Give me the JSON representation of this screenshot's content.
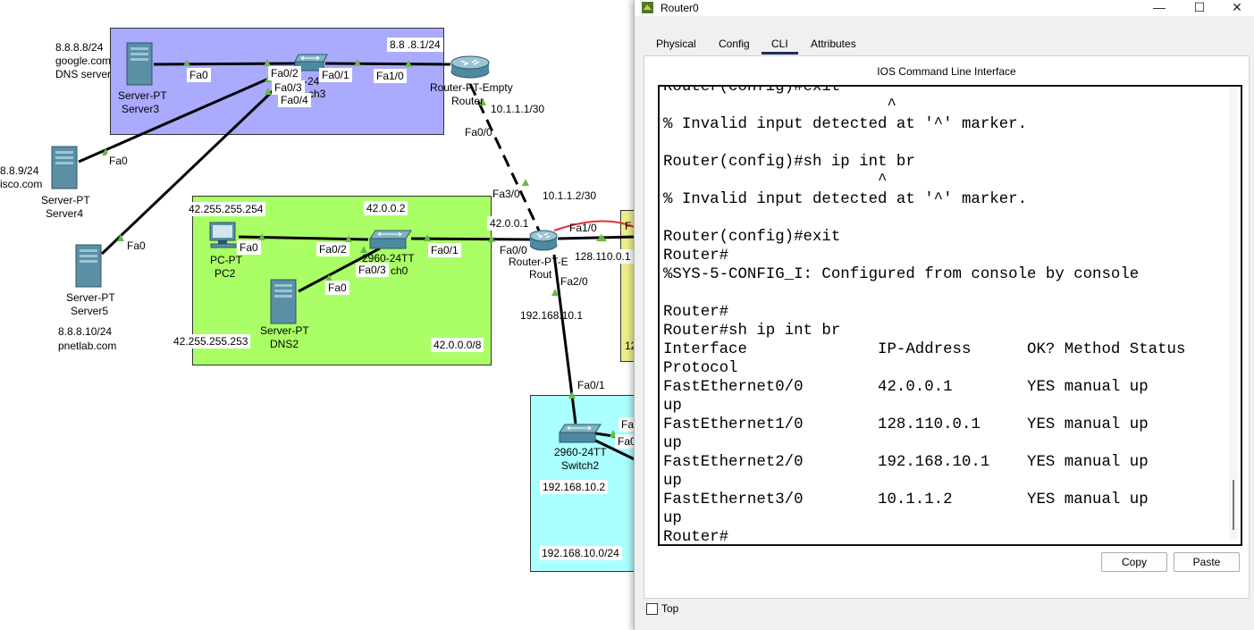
{
  "topology": {
    "labels": {
      "dns_server_ip": "8.8.8.8/24",
      "dns_server_domain": "google.com",
      "dns_server_role": "DNS server",
      "server3_type": "Server-PT",
      "server3_name": "Server3",
      "server3_port": "Fa0",
      "switch3_fa02": "Fa0/2",
      "switch3_fa03": "Fa0/3",
      "switch3_fa04": "Fa0/4",
      "switch3_fa01": "Fa0/1",
      "switch3_name_partial": "-24",
      "switch3_name2_partial": "ch3",
      "router_fa10": "Fa1/0",
      "gateway_ip": "8.8 .8.1/24",
      "router_top_type": "Router-PT-Empty",
      "router_top_name": "Router",
      "router_top_link_ip": "10.1.1.1/30",
      "router_top_fa00": "Fa0/0",
      "server4_ip_partial": "8.8.9/24",
      "server4_domain_partial": "isco.com",
      "server4_port": "Fa0",
      "server4_type": "Server-PT",
      "server4_name": "Server4",
      "server5_port": "Fa0",
      "server5_type": "Server-PT",
      "server5_name": "Server5",
      "server5_ip": "8.8.8.10/24",
      "server5_domain": "pnetlab.com",
      "area_green_ip1": "42.255.255.254",
      "area_green_net": "42.0.0.2",
      "pc2_port": "Fa0",
      "switch0_fa02": "Fa0/2",
      "switch0_name": "2960-24TT",
      "switch0_fa03": "Fa0/3",
      "switch0_name2_partial": "ch0",
      "switch0_fa01": "Fa0/1",
      "pc2_type": "PC-PT",
      "pc2_name": "PC2",
      "dns2_port": "Fa0",
      "dns2_type": "Server-PT",
      "dns2_name": "DNS2",
      "area_green_ip2": "42.255.255.253",
      "area_green_subnet": "42.0.0.0/8",
      "router0_fa30": "Fa3/0",
      "router0_link_ip": "10.1.1.2/30",
      "router0_ip1": "42.0.0.1",
      "router0_fa00": "Fa0/0",
      "router0_fa10": "Fa1/0",
      "router0_ip2": "128.110.0.1",
      "router0_type_partial": "Router-PT-E",
      "router0_name_partial": "Rout",
      "router0_fa20": "Fa2/0",
      "router0_ip3": "192.168.10.1",
      "switch2_fa01": "Fa0/1",
      "switch2_type": "2960-24TT",
      "switch2_name": "Switch2",
      "switch2_ip": "192.168.10.2",
      "switch2_fa_partial1": "Fa",
      "switch2_fa_partial2": "Fa0",
      "area_cyan_subnet": "192.168.10.0/24",
      "yellow_partial1": "F",
      "yellow_partial2": "12"
    },
    "colors": {
      "area_blue": "#aaaaff",
      "area_green": "#aaff66",
      "area_cyan": "#aaffff",
      "area_yellow": "#eeee88",
      "link_up": "#66bb44",
      "annotation_arrow": "#e03030"
    }
  },
  "window": {
    "title": "Router0",
    "controls": {
      "minimize": "—",
      "maximize": "☐",
      "close": "✕"
    },
    "tabs": [
      {
        "label": "Physical"
      },
      {
        "label": "Config"
      },
      {
        "label": "CLI"
      },
      {
        "label": "Attributes"
      }
    ],
    "active_tab": "CLI",
    "panel_title": "IOS Command Line Interface",
    "cli_output": "Router(config)#exit\n                        ^\n% Invalid input detected at '^' marker.\n\nRouter(config)#sh ip int br\n                       ^\n% Invalid input detected at '^' marker.\n\nRouter(config)#exit\nRouter#\n%SYS-5-CONFIG_I: Configured from console by console\n\nRouter#\nRouter#sh ip int br\nInterface              IP-Address      OK? Method Status\nProtocol\nFastEthernet0/0        42.0.0.1        YES manual up\nup\nFastEthernet1/0        128.110.0.1     YES manual up\nup\nFastEthernet2/0        192.168.10.1    YES manual up\nup\nFastEthernet3/0        10.1.1.2        YES manual up\nup\nRouter#",
    "copy_label": "Copy",
    "paste_label": "Paste",
    "top_label": "Top"
  }
}
